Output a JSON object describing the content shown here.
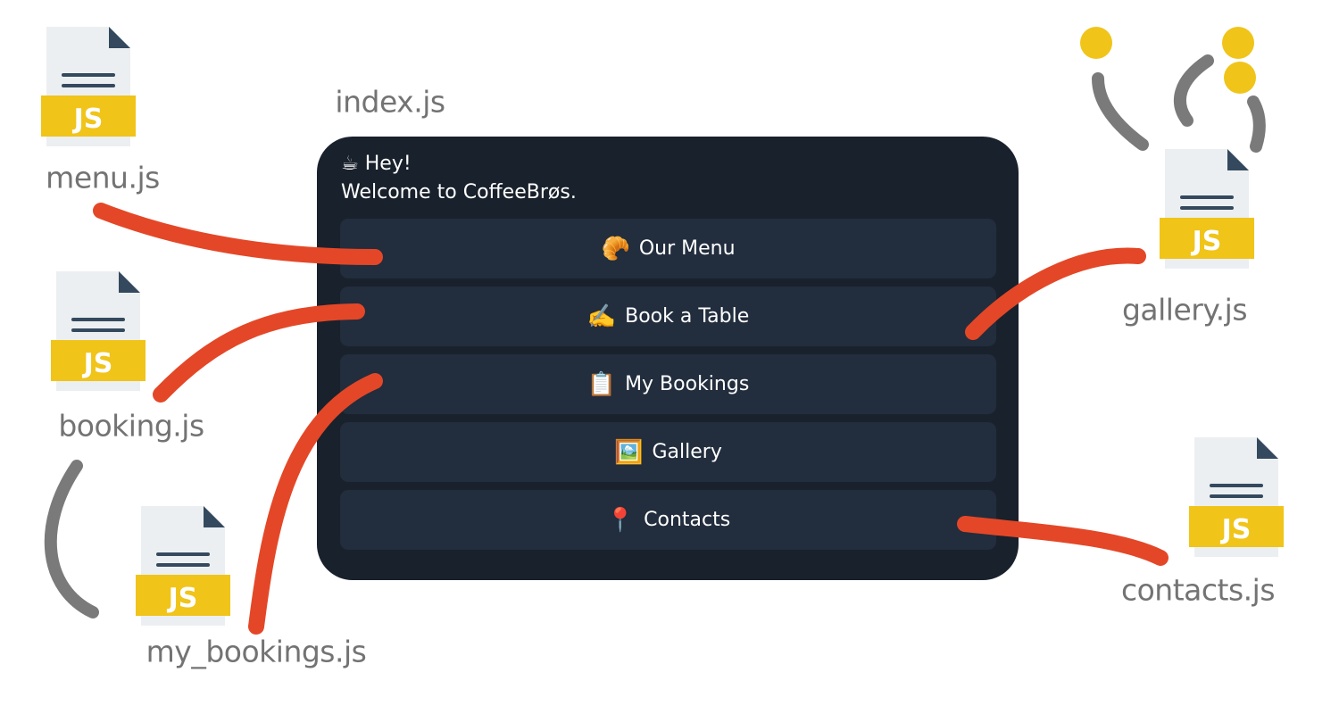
{
  "files": {
    "index": "index.js",
    "menu": "menu.js",
    "booking": "booking.js",
    "my_bookings": "my_bookings.js",
    "gallery": "gallery.js",
    "contacts": "contacts.js",
    "badge": "JS"
  },
  "app": {
    "greeting_icon": "☕",
    "greeting_line1": "Hey!",
    "greeting_line2": "Welcome to CoffeeBrøs.",
    "buttons": [
      {
        "icon": "🥐",
        "label": "Our Menu"
      },
      {
        "icon": "✍️",
        "label": "Book a Table"
      },
      {
        "icon": "📋",
        "label": "My Bookings"
      },
      {
        "icon": "🖼️",
        "label": "Gallery"
      },
      {
        "icon": "📍",
        "label": "Contacts"
      }
    ]
  },
  "colors": {
    "panel": "#19212c",
    "button": "#222d3d",
    "connector": "#e44727",
    "arc": "#7a7a7a",
    "dot": "#f0c419",
    "js_badge": "#f0c419",
    "file_page": "#eceff1",
    "file_fold": "#34495e"
  }
}
